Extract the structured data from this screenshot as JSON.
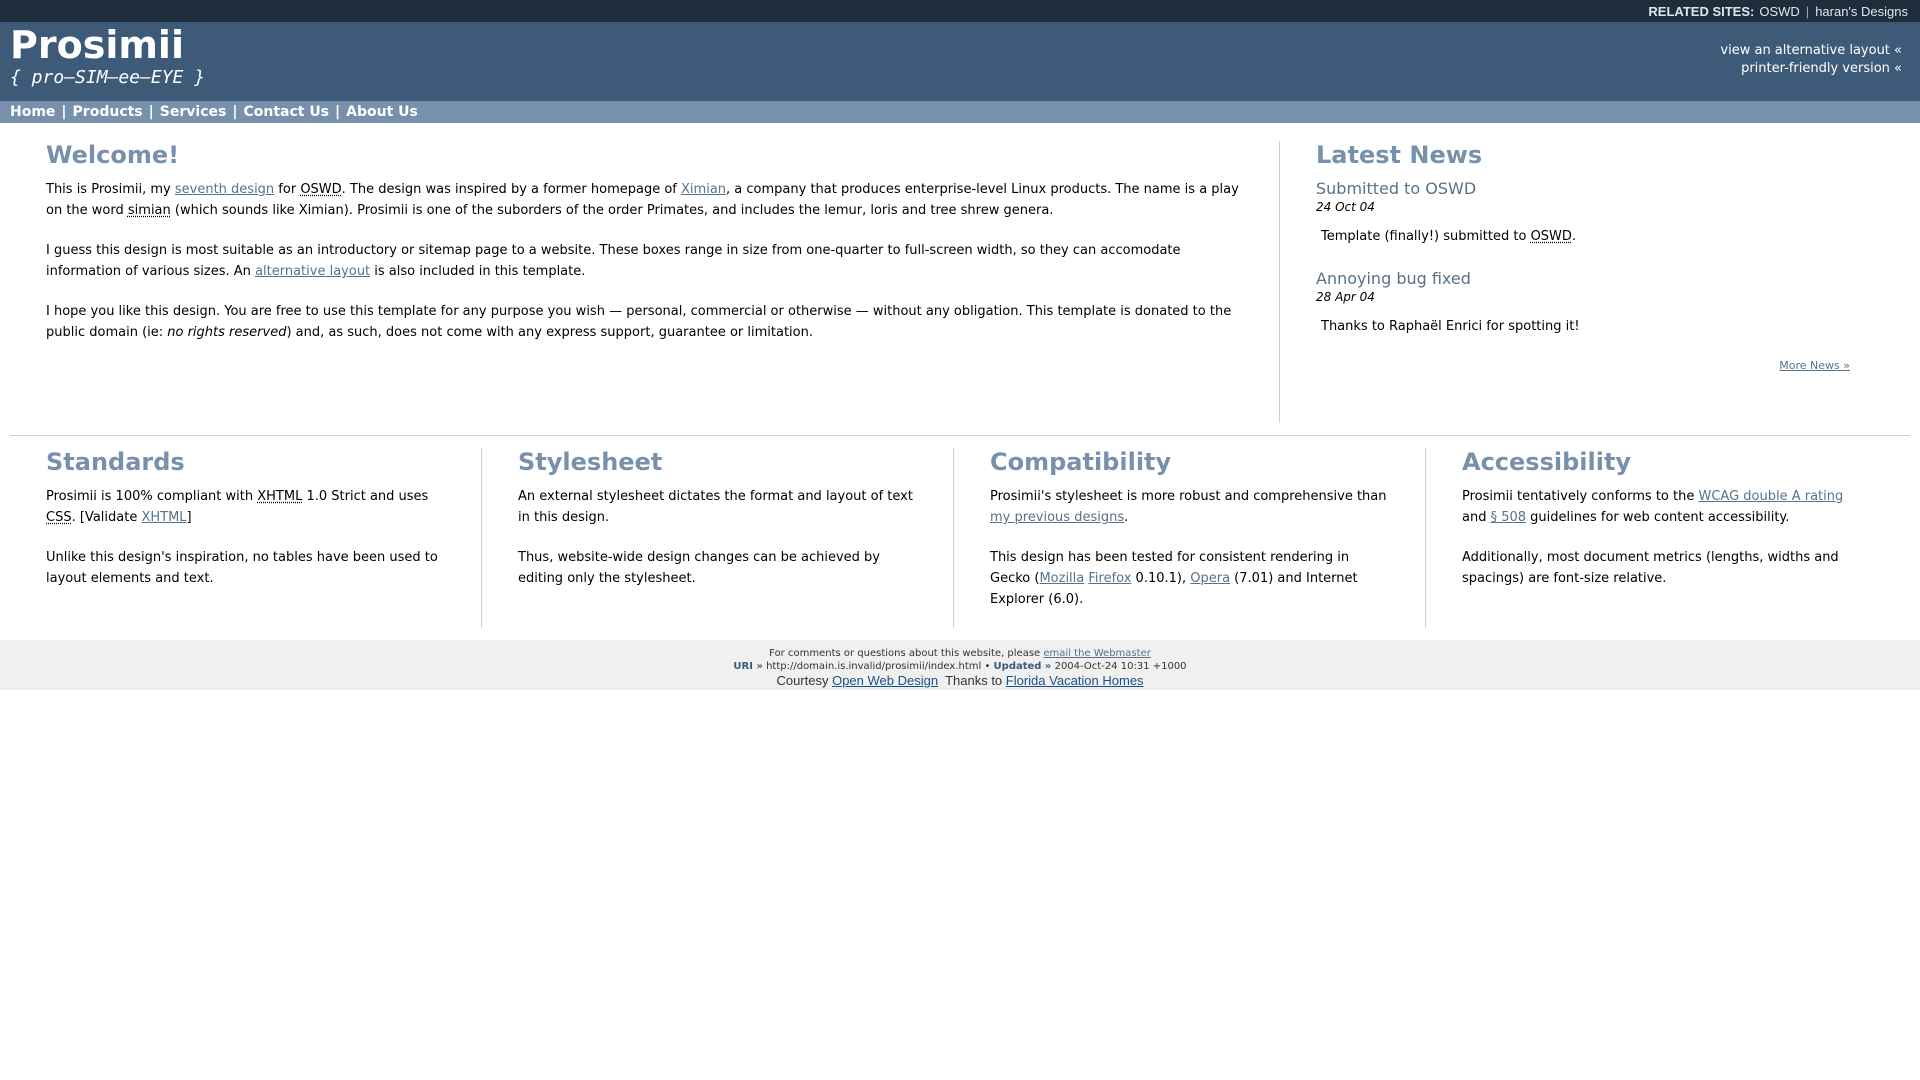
{
  "related": {
    "label": "RELATED SITES:",
    "links": [
      "OSWD",
      "haran's Designs"
    ]
  },
  "header": {
    "title": "Prosimii",
    "subtitle": "{ pro–SIM–ee–EYE }",
    "alt_layout": "view an alternative layout «",
    "printer": "printer-friendly version «"
  },
  "nav": [
    "Home",
    "Products",
    "Services",
    "Contact Us",
    "About Us"
  ],
  "welcome": {
    "title": "Welcome!",
    "p1": {
      "a": "This is Prosimii, my ",
      "link1": "seventh design",
      "b": " for ",
      "abbr1": "OSWD",
      "c": ". The design was inspired by a former homepage of ",
      "link2": "Ximian",
      "d": ", a company that produces enterprise-level Linux products. The name is a play on the word ",
      "abbr2": "simian",
      "e": " (which sounds like Ximian). Prosimii is one of the suborders of the order Primates, and includes the lemur, loris and tree shrew genera."
    },
    "p2": {
      "a": "I guess this design is most suitable as an introductory or sitemap page to a website. These boxes range in size from one-quarter to full-screen width, so they can accomodate information of various sizes. An ",
      "link": "alternative layout",
      "b": " is also included in this template."
    },
    "p3": {
      "a": "I hope you like this design. You are free to use this template for any purpose you wish — personal, commercial or otherwise — without any obligation. This template is donated to the public domain (ie: ",
      "em": "no rights reserved",
      "b": ") and, as such, does not come with any express support, guarantee or limitation."
    }
  },
  "news": {
    "title": "Latest News",
    "items": [
      {
        "title": "Submitted to OSWD",
        "date": "24 Oct 04",
        "text_a": "Template (finally!) submitted to ",
        "abbr": "OSWD",
        "text_b": "."
      },
      {
        "title": "Annoying bug fixed",
        "date": "28 Apr 04",
        "text_a": "Thanks to Raphaël Enrici for spotting it!",
        "abbr": "",
        "text_b": ""
      }
    ],
    "more": "More News »"
  },
  "boxes": {
    "standards": {
      "title": "Standards",
      "p1_a": "Prosimii is 100% compliant with ",
      "p1_abbr1": "XHTML",
      "p1_b": " 1.0 Strict and uses ",
      "p1_abbr2": "CSS",
      "p1_c": ". [Validate ",
      "p1_link": "XHTML",
      "p1_d": "]",
      "p2": "Unlike this design's inspiration, no tables have been used to layout elements and text."
    },
    "stylesheet": {
      "title": "Stylesheet",
      "p1": "An external stylesheet dictates the format and layout of text in this design.",
      "p2": "Thus, website-wide design changes can be achieved by editing only the stylesheet."
    },
    "compat": {
      "title": "Compatibility",
      "p1_a": "Prosimii's stylesheet is more robust and comprehensive than ",
      "p1_link": "my previous designs",
      "p1_b": ".",
      "p2_a": "This design has been tested for consistent rendering in Gecko (",
      "link_mozilla": "Mozilla",
      "link_firefox": "Firefox",
      "p2_b": " 0.10.1), ",
      "link_opera": "Opera",
      "p2_c": " (7.01) and Internet Explorer (6.0)."
    },
    "access": {
      "title": "Accessibility",
      "p1_a": "Prosimii tentatively conforms to the ",
      "p1_link1": "WCAG double A rating",
      "p1_b": " and ",
      "p1_link2": "§ 508",
      "p1_c": " guidelines for web content accessibility.",
      "p2": "Additionally, most document metrics (lengths, widths and spacings) are font-size relative."
    }
  },
  "footer": {
    "l1_a": "For comments or questions about this website, please ",
    "l1_link": "email the Webmaster",
    "uri_label": "URI »",
    "uri": " http://domain.is.invalid/prosimii/index.html • ",
    "updated_label": "Updated »",
    "updated": " 2004-Oct-24 10:31 +1000",
    "courtesy": "Courtesy ",
    "courtesy_link": "Open Web Design",
    "thanks": "  Thanks to ",
    "thanks_link": "Florida Vacation Homes"
  }
}
